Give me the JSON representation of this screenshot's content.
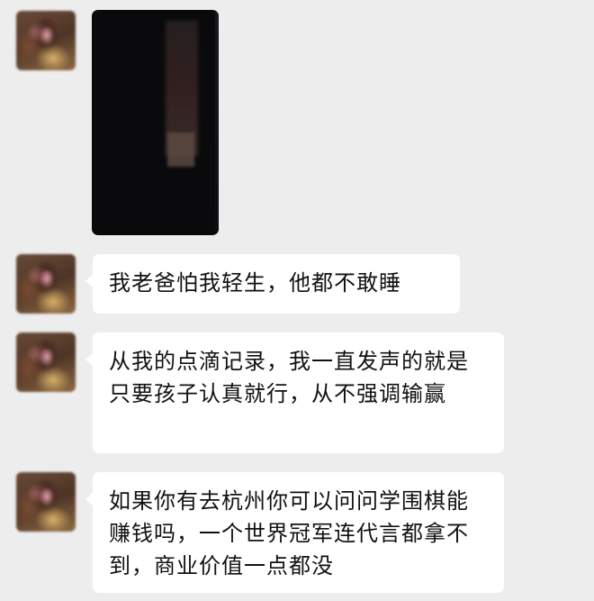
{
  "chat": {
    "messages": [
      {
        "type": "video"
      },
      {
        "type": "text",
        "text": "我老爸怕我轻生，他都不敢睡"
      },
      {
        "type": "text",
        "text": "从我的点滴记录，我一直发声的就是只要孩子认真就行，从不强调输赢"
      },
      {
        "type": "text",
        "text": "如果你有去杭州你可以问问学围棋能赚钱吗，一个世界冠军连代言都拿不到，商业价值一点都没"
      }
    ]
  }
}
